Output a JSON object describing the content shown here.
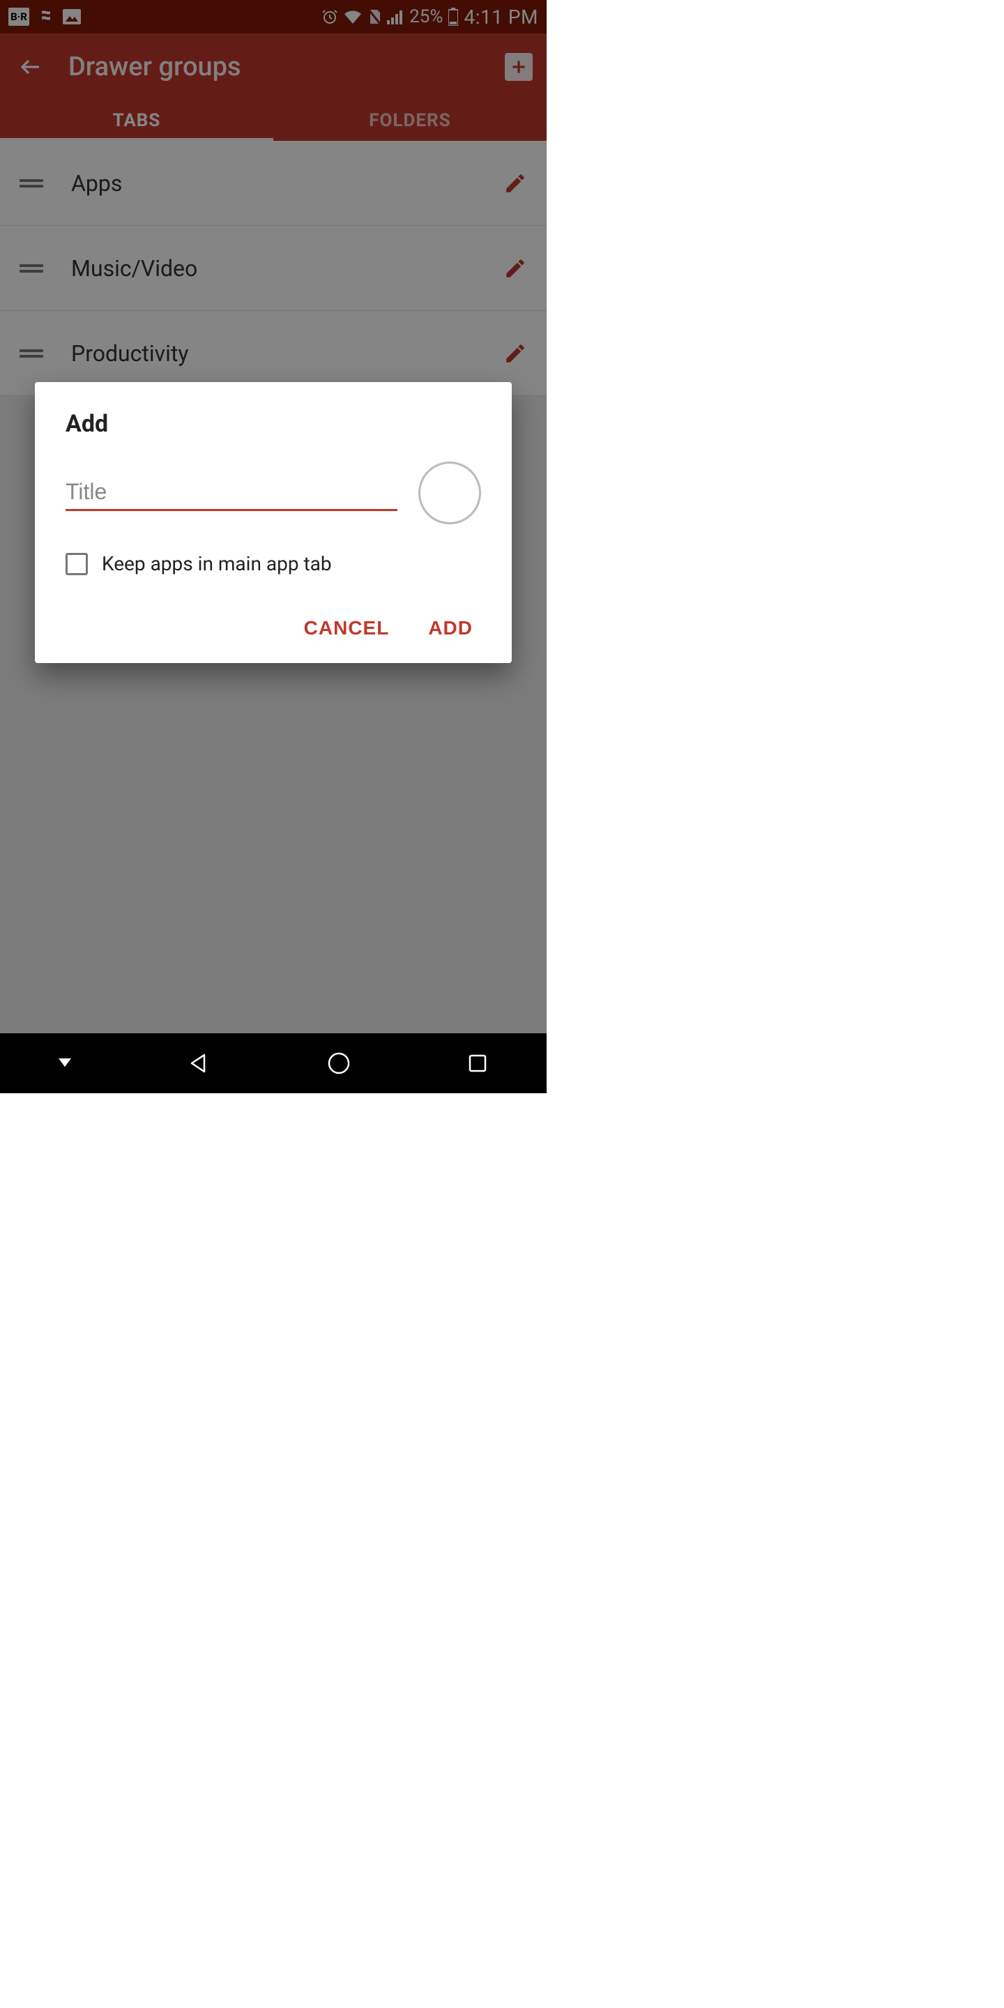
{
  "statusbar": {
    "br_label": "B·R",
    "battery_pct": "25%",
    "clock": "4:11 PM"
  },
  "appbar": {
    "title": "Drawer groups"
  },
  "tabs": {
    "tabs_label": "TABS",
    "folders_label": "FOLDERS"
  },
  "rows": {
    "r0": "Apps",
    "r1": "Music/Video",
    "r2": "Productivity"
  },
  "dialog": {
    "title": "Add",
    "title_placeholder": "Title",
    "title_value": "",
    "keep_label": "Keep apps in main app tab",
    "cancel": "CANCEL",
    "add": "ADD"
  }
}
